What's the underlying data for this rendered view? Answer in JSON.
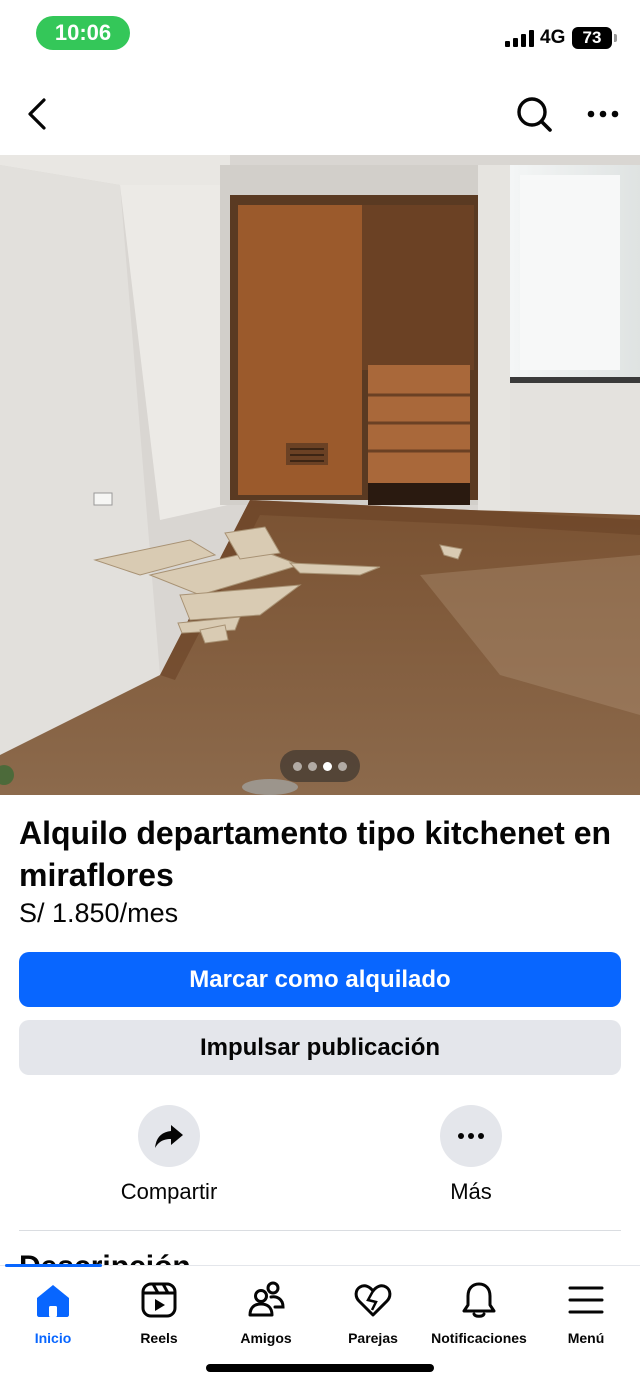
{
  "status_bar": {
    "time": "10:06",
    "network": "4G",
    "battery": "73"
  },
  "photo": {
    "total_images": 4,
    "current_index": 3
  },
  "listing": {
    "title": "Alquilo departamento tipo kitchenet en miraflores",
    "price": "S/ 1.850/mes",
    "primary_button": "Marcar como alquilado",
    "secondary_button": "Impulsar publicación",
    "actions": [
      {
        "label": "Compartir",
        "icon": "share-icon"
      },
      {
        "label": "Más",
        "icon": "more-icon"
      }
    ],
    "next_section_peek": "Descripción"
  },
  "tab_bar": {
    "active": "Inicio",
    "tabs": [
      {
        "label": "Inicio",
        "icon": "home-icon"
      },
      {
        "label": "Reels",
        "icon": "reels-icon"
      },
      {
        "label": "Amigos",
        "icon": "friends-icon"
      },
      {
        "label": "Parejas",
        "icon": "dating-heart-icon"
      },
      {
        "label": "Notificaciones",
        "icon": "bell-icon"
      },
      {
        "label": "Menú",
        "icon": "menu-icon"
      }
    ]
  },
  "colors": {
    "brand_blue": "#0866ff",
    "secondary_gray": "#e4e6eb",
    "status_green": "#34c759"
  }
}
